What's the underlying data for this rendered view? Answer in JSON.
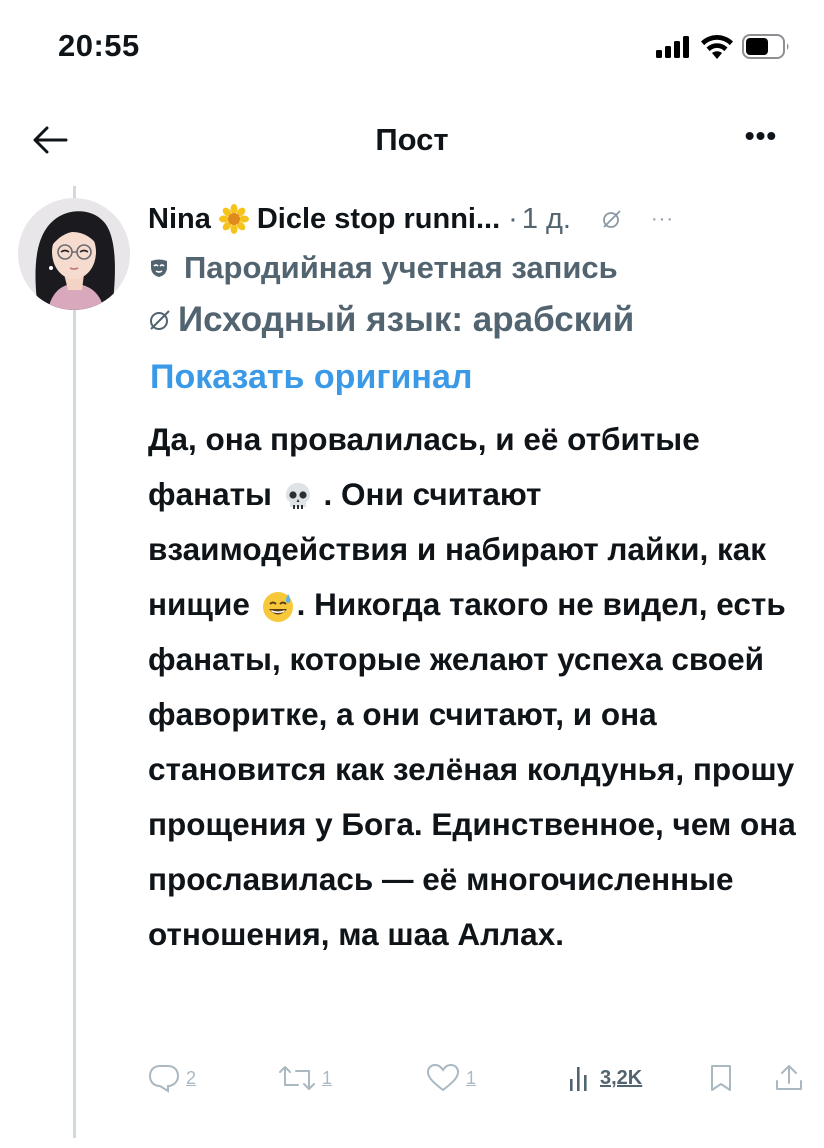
{
  "status_bar": {
    "time": "20:55"
  },
  "header": {
    "title": "Пост"
  },
  "post": {
    "author_name": "Nina",
    "author_name2": "Dicle stop runni...",
    "time_sep": "·",
    "time": "1 д.",
    "parody_label": "Пародийная учетная запись",
    "source_language": "Исходный язык: арабский",
    "show_original": "Показать оригинал",
    "body_parts": [
      "Да, она провалилась, и её отбитые фанаты ",
      " . Они считают взаимодействия и набирают лайки, как нищие ",
      ". Никогда такого не видел, есть фанаты, которые желают успеха своей фаворитке, а они считают, и она становится как зелёная колдунья, прошу прощения у Бога. Единственное, чем она прославилась — её многочисленные отношения, ма шаа Аллах."
    ],
    "emojis": [
      "skull-emoji",
      "sweat-smile-emoji"
    ]
  },
  "actions": {
    "replies": "2",
    "reposts": "1",
    "likes": "1",
    "views": "3,2K"
  },
  "colors": {
    "text": "#0f1419",
    "secondary": "#536471",
    "link": "#3a9ae8",
    "thread_line": "#cfd9de",
    "action_icon": "#aab8c2"
  }
}
